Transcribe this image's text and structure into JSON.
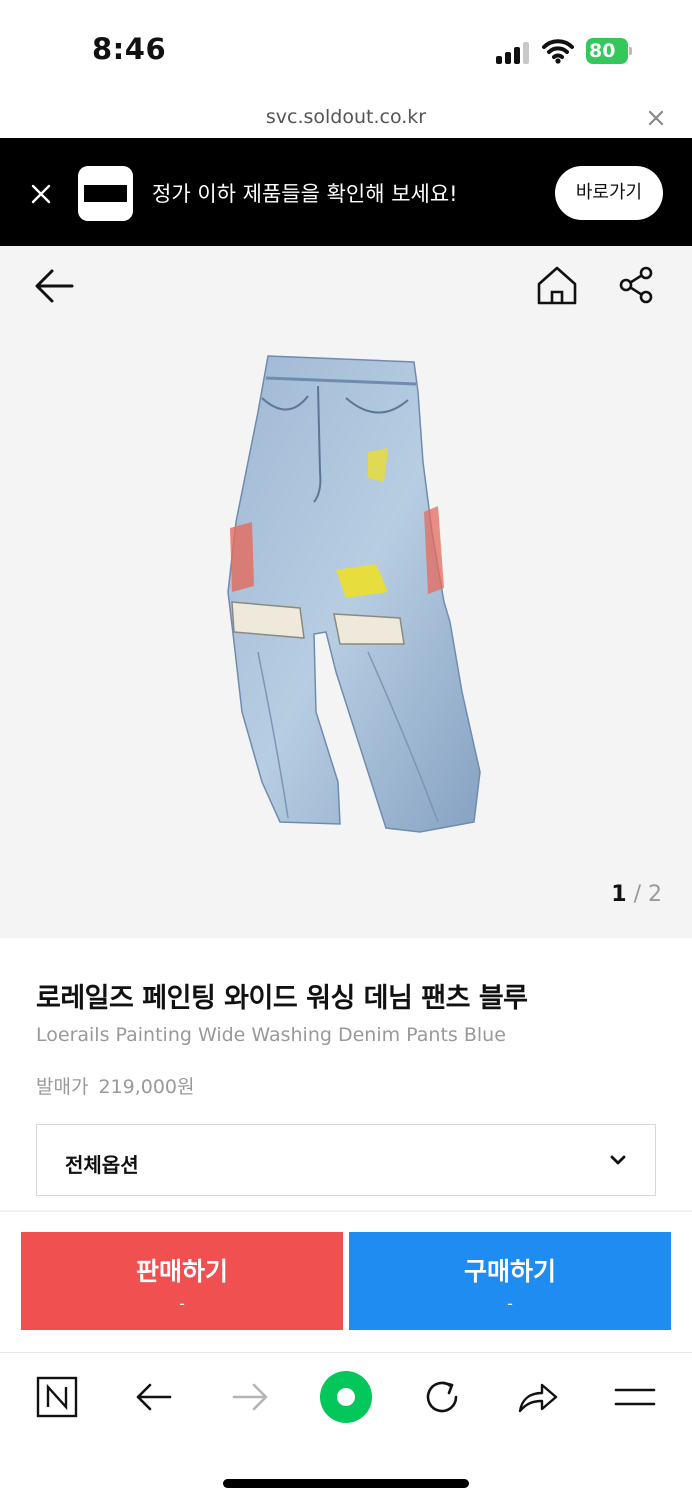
{
  "status_bar": {
    "time": "8:46",
    "battery": "80"
  },
  "url_bar": {
    "url": "svc.soldout.co.kr"
  },
  "promo_banner": {
    "message": "정가 이하 제품들을 확인해 보세요!",
    "button_label": "바로가기"
  },
  "gallery": {
    "current": "1",
    "separator": " / ",
    "total": "2",
    "image_alt": "Denim wide jeans with paint splatter and distressed knees"
  },
  "product": {
    "title_ko": "로레일즈 페인팅 와이드 워싱 데님 팬츠 블루",
    "title_en": "Loerails Painting Wide Washing Denim Pants Blue",
    "release_price_label": "발매가",
    "release_price": "219,000원"
  },
  "options": {
    "selected": "전체옵션"
  },
  "actions": {
    "sell": {
      "label": "판매하기",
      "price": "-"
    },
    "buy": {
      "label": "구매하기",
      "price": "-"
    }
  },
  "colors": {
    "sell": "#f0504f",
    "buy": "#1e8cf0",
    "battery": "#34c759",
    "naver_green": "#03c75a"
  },
  "toolbar_icons": [
    "naver-n-icon",
    "back-arrow-icon",
    "forward-arrow-icon",
    "green-dot-icon",
    "refresh-icon",
    "share-arrow-icon",
    "menu-icon"
  ]
}
